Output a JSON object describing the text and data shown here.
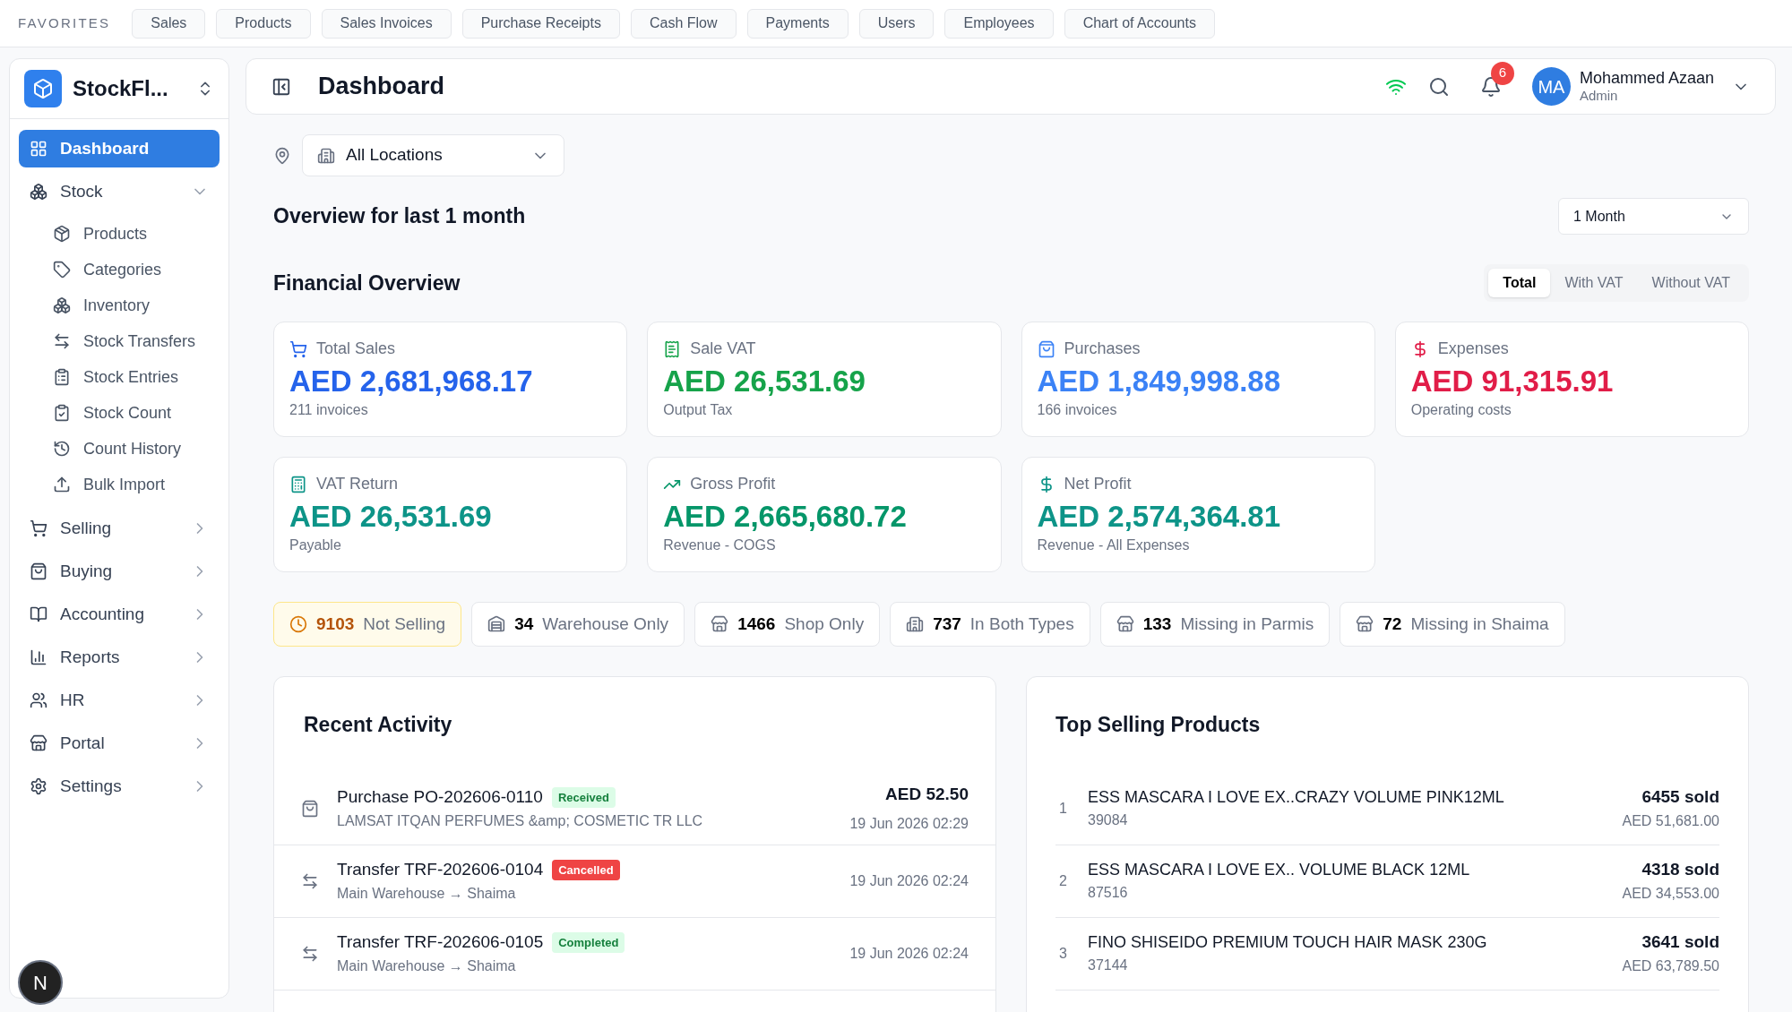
{
  "favorites": {
    "label": "FAVORITES",
    "items": [
      "Sales",
      "Products",
      "Sales Invoices",
      "Purchase Receipts",
      "Cash Flow",
      "Payments",
      "Users",
      "Employees",
      "Chart of Accounts"
    ]
  },
  "sidebar": {
    "app_name": "StockFl...",
    "avatar_letter": "N",
    "items": [
      {
        "label": "Dashboard",
        "selected": true
      },
      {
        "label": "Stock",
        "selected": false,
        "expanded": true,
        "children": [
          {
            "label": "Products"
          },
          {
            "label": "Categories"
          },
          {
            "label": "Inventory"
          },
          {
            "label": "Stock Transfers"
          },
          {
            "label": "Stock Entries"
          },
          {
            "label": "Stock Count"
          },
          {
            "label": "Count History"
          },
          {
            "label": "Bulk Import"
          }
        ]
      },
      {
        "label": "Selling",
        "selected": false,
        "expanded": false
      },
      {
        "label": "Buying",
        "selected": false,
        "expanded": false
      },
      {
        "label": "Accounting",
        "selected": false,
        "expanded": false
      },
      {
        "label": "Reports",
        "selected": false,
        "expanded": false
      },
      {
        "label": "HR",
        "selected": false,
        "expanded": false
      },
      {
        "label": "Portal",
        "selected": false,
        "expanded": false
      },
      {
        "label": "Settings",
        "selected": false,
        "expanded": false
      }
    ]
  },
  "header": {
    "title": "Dashboard",
    "notifications": "6",
    "user": {
      "initials": "MA",
      "name": "Mohammed Azaan",
      "role": "Admin"
    }
  },
  "location": {
    "value": "All Locations"
  },
  "overview": {
    "title": "Overview for last 1 month",
    "period": "1 Month"
  },
  "financial": {
    "title": "Financial Overview",
    "tabs": [
      {
        "label": "Total",
        "selected": true
      },
      {
        "label": "With VAT",
        "selected": false
      },
      {
        "label": "Without VAT",
        "selected": false
      }
    ],
    "cards": [
      {
        "label": "Total Sales",
        "value": "AED 2,681,968.17",
        "note": "211 invoices",
        "color": "#2563eb"
      },
      {
        "label": "Sale VAT",
        "value": "AED 26,531.69",
        "note": "Output Tax",
        "color": "#16a34a"
      },
      {
        "label": "Purchases",
        "value": "AED 1,849,998.88",
        "note": "166 invoices",
        "color": "#3b82f6"
      },
      {
        "label": "Expenses",
        "value": "AED 91,315.91",
        "note": "Operating costs",
        "color": "#e11d48"
      },
      {
        "label": "VAT Return",
        "value": "AED 26,531.69",
        "note": "Payable",
        "color": "#0d9488"
      },
      {
        "label": "Gross Profit",
        "value": "AED 2,665,680.72",
        "note": "Revenue - COGS",
        "color": "#059669"
      },
      {
        "label": "Net Profit",
        "value": "AED 2,574,364.81",
        "note": "Revenue - All Expenses",
        "color": "#0d9488"
      }
    ]
  },
  "stock_counts": [
    {
      "count": "9103",
      "label": "Not Selling",
      "highlighted": true
    },
    {
      "count": "34",
      "label": "Warehouse Only",
      "highlighted": false
    },
    {
      "count": "1466",
      "label": "Shop Only",
      "highlighted": false
    },
    {
      "count": "737",
      "label": "In Both Types",
      "highlighted": false
    },
    {
      "count": "133",
      "label": "Missing in Parmis",
      "highlighted": false
    },
    {
      "count": "72",
      "label": "Missing in Shaima",
      "highlighted": false
    }
  ],
  "recent_activity": {
    "title": "Recent Activity",
    "items": [
      {
        "kind": "purchase",
        "title": "Purchase PO-202606-0110",
        "status": {
          "label": "Received",
          "kind": "success"
        },
        "subtitle": "LAMSAT ITQAN PERFUMES &amp; COSMETIC TR LLC",
        "amount": "AED 52.50",
        "time": "19 Jun 2026 02:29"
      },
      {
        "kind": "transfer",
        "title": "Transfer TRF-202606-0104",
        "status": {
          "label": "Cancelled",
          "kind": "danger"
        },
        "subtitle": "Main Warehouse → Shaima",
        "time": "19 Jun 2026 02:24"
      },
      {
        "kind": "transfer",
        "title": "Transfer TRF-202606-0105",
        "status": {
          "label": "Completed",
          "kind": "success"
        },
        "subtitle": "Main Warehouse → Shaima",
        "time": "19 Jun 2026 02:24"
      }
    ]
  },
  "top_selling": {
    "title": "Top Selling Products",
    "items": [
      {
        "rank": "1",
        "name": "ESS MASCARA I LOVE EX..CRAZY VOLUME PINK12ML",
        "code": "39084",
        "sold": "6455 sold",
        "amount": "AED 51,681.00"
      },
      {
        "rank": "2",
        "name": "ESS MASCARA I LOVE EX.. VOLUME BLACK 12ML",
        "code": "87516",
        "sold": "4318 sold",
        "amount": "AED 34,553.00"
      },
      {
        "rank": "3",
        "name": "FINO SHISEIDO PREMIUM TOUCH HAIR MASK 230G",
        "code": "37144",
        "sold": "3641 sold",
        "amount": "AED 63,789.50"
      }
    ]
  }
}
